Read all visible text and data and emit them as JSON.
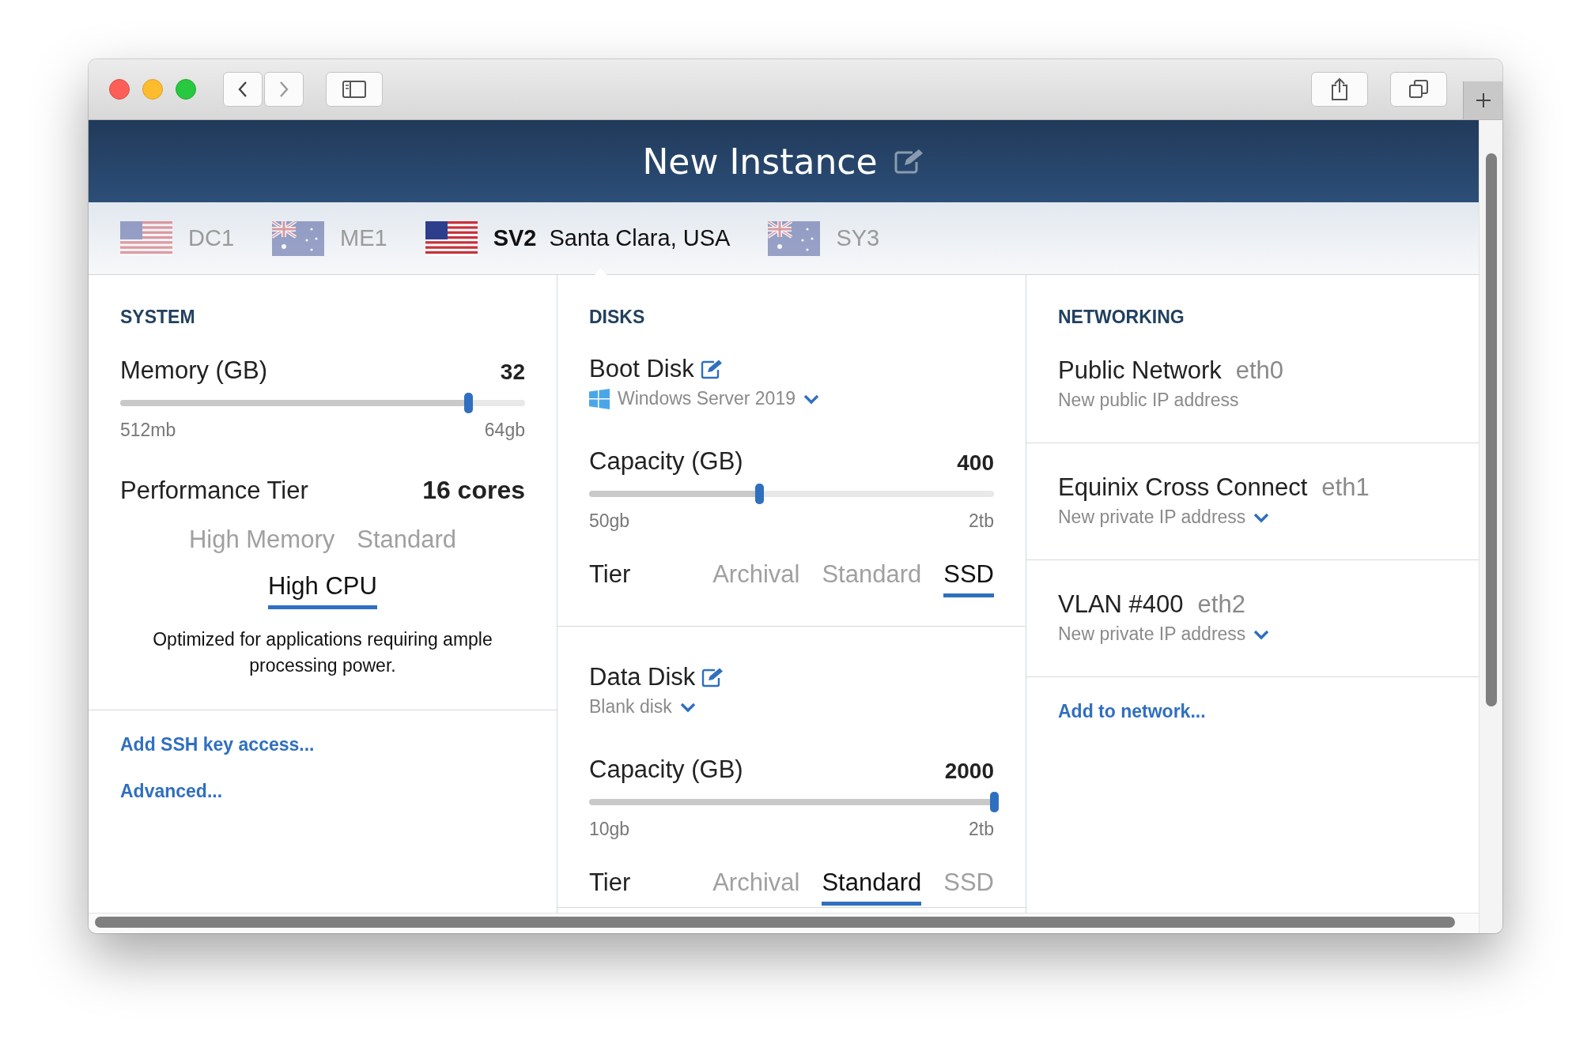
{
  "window": {
    "title": "New Instance"
  },
  "datacenters": [
    {
      "code": "DC1",
      "kind": "us",
      "selected": false
    },
    {
      "code": "ME1",
      "kind": "au",
      "selected": false
    },
    {
      "code": "SV2",
      "name": "Santa Clara, USA",
      "kind": "us",
      "selected": true
    },
    {
      "code": "SY3",
      "kind": "au",
      "selected": false
    }
  ],
  "system": {
    "heading": "SYSTEM",
    "memory": {
      "label": "Memory (GB)",
      "value": "32",
      "level": 0.86,
      "min": "512mb",
      "max": "64gb"
    },
    "performance": {
      "label": "Performance Tier",
      "value": "16 cores",
      "options": [
        {
          "label": "High Memory",
          "selected": false
        },
        {
          "label": "Standard",
          "selected": false
        },
        {
          "label": "High CPU",
          "selected": true
        }
      ],
      "description": "Optimized for applications requiring ample processing power."
    },
    "links": [
      "Add SSH key access...",
      "Advanced..."
    ]
  },
  "disks": {
    "heading": "DISKS",
    "items": [
      {
        "title": "Boot Disk",
        "kind": "windows",
        "image": "Windows Server 2019",
        "capacity": {
          "label": "Capacity (GB)",
          "value": "400",
          "level": 0.42,
          "min": "50gb",
          "max": "2tb"
        },
        "tier_label": "Tier",
        "tiers": [
          {
            "label": "Archival",
            "selected": false
          },
          {
            "label": "Standard",
            "selected": false
          },
          {
            "label": "SSD",
            "selected": true
          }
        ]
      },
      {
        "title": "Data Disk",
        "kind": "blank",
        "image": "Blank disk",
        "capacity": {
          "label": "Capacity (GB)",
          "value": "2000",
          "level": 1.0,
          "min": "10gb",
          "max": "2tb"
        },
        "tier_label": "Tier",
        "tiers": [
          {
            "label": "Archival",
            "selected": false
          },
          {
            "label": "Standard",
            "selected": true
          },
          {
            "label": "SSD",
            "selected": false
          }
        ]
      }
    ]
  },
  "networking": {
    "heading": "NETWORKING",
    "items": [
      {
        "name": "Public Network",
        "interface": "eth0",
        "address": "New public IP address",
        "dropdown": false
      },
      {
        "name": "Equinix Cross Connect",
        "interface": "eth1",
        "address": "New private IP address",
        "dropdown": true
      },
      {
        "name": "VLAN #400",
        "interface": "eth2",
        "address": "New private IP address",
        "dropdown": true
      }
    ],
    "link": "Add to network..."
  }
}
